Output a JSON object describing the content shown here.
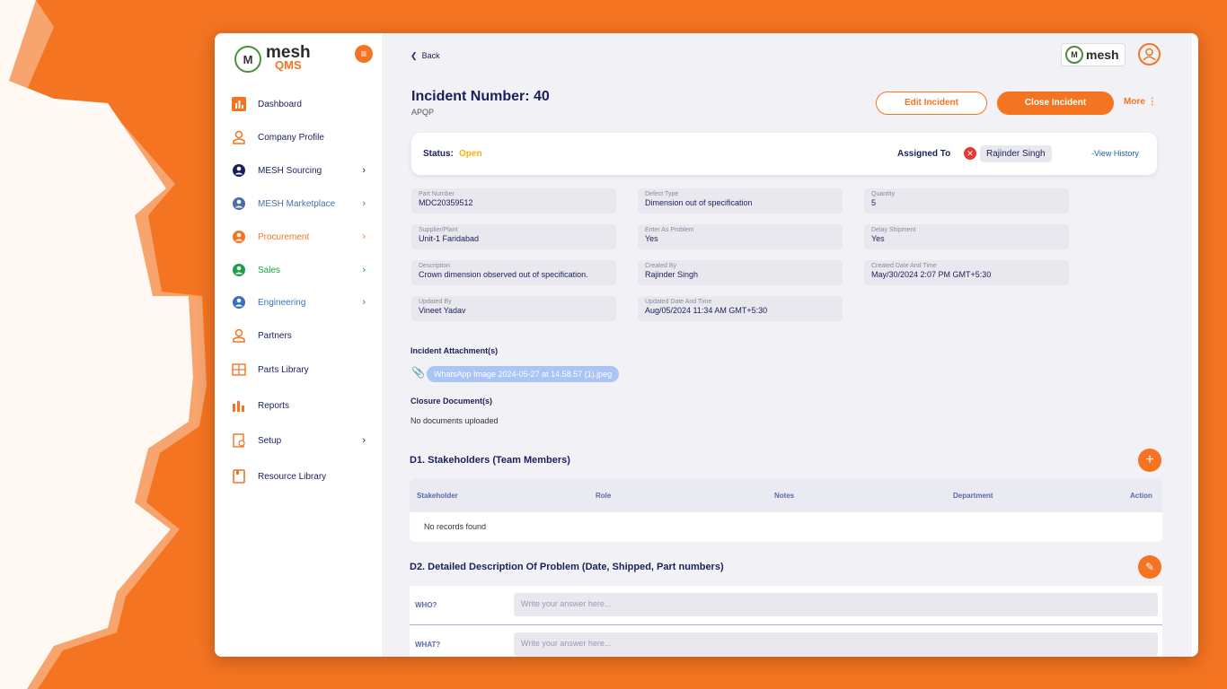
{
  "app": {
    "logo_main": "mesh",
    "logo_sub": "QMS",
    "brand_small": "mesh"
  },
  "sidebar": {
    "items": [
      {
        "label": "Dashboard",
        "icon": "bar-chart-icon",
        "chevron": false,
        "color": "#1a1f5c"
      },
      {
        "label": "Company Profile",
        "icon": "user-outline-icon",
        "chevron": false,
        "color": "#1a1f5c"
      },
      {
        "label": "MESH Sourcing",
        "icon": "user-circle-icon",
        "chevron": true,
        "color": "#1a1f5c"
      },
      {
        "label": "MESH Marketplace",
        "icon": "user-circle-icon",
        "chevron": true,
        "color": "#4a6fa5"
      },
      {
        "label": "Procurement",
        "icon": "user-circle-icon",
        "chevron": true,
        "color": "#f47421"
      },
      {
        "label": "Sales",
        "icon": "user-circle-icon",
        "chevron": true,
        "color": "#1e9e4a"
      },
      {
        "label": "Engineering",
        "icon": "user-circle-icon",
        "chevron": true,
        "color": "#3a6fc8"
      },
      {
        "label": "Partners",
        "icon": "partners-icon",
        "chevron": false,
        "color": "#1a1f5c"
      },
      {
        "label": "Parts Library",
        "icon": "grid-icon",
        "chevron": false,
        "color": "#1a1f5c"
      },
      {
        "label": "Reports",
        "icon": "reports-icon",
        "chevron": false,
        "color": "#1a1f5c"
      },
      {
        "label": "Setup",
        "icon": "setup-icon",
        "chevron": true,
        "color": "#1a1f5c"
      },
      {
        "label": "Resource Library",
        "icon": "book-icon",
        "chevron": false,
        "color": "#1a1f5c"
      }
    ]
  },
  "header": {
    "back_label": "Back",
    "title": "Incident Number: 40",
    "subtitle": "APQP",
    "edit_label": "Edit Incident",
    "close_label": "Close Incident",
    "more_label": "More"
  },
  "status": {
    "status_label": "Status:",
    "status_value": "Open",
    "assigned_label": "Assigned To",
    "assignee": "Rajinder Singh",
    "history_label": "-View History"
  },
  "fields": [
    {
      "label": "Part Number",
      "value": "MDC20359512"
    },
    {
      "label": "Defect Type",
      "value": "Dimension out of specification"
    },
    {
      "label": "Quantity",
      "value": "5"
    },
    {
      "label": "Supplier/Plant",
      "value": "Unit-1  Faridabad"
    },
    {
      "label": "Enter As Problem",
      "value": "Yes"
    },
    {
      "label": "Delay Shipment",
      "value": "Yes"
    },
    {
      "label": "Description",
      "value": "Crown dimension observed out of specification."
    },
    {
      "label": "Created By",
      "value": "Rajinder Singh"
    },
    {
      "label": "Created Date And Time",
      "value": "May/30/2024 2:07 PM GMT+5:30"
    },
    {
      "label": "Updated By",
      "value": "Vineet Yadav"
    },
    {
      "label": "Updated Date And Time",
      "value": "Aug/05/2024 11:34 AM GMT+5:30"
    }
  ],
  "attachments": {
    "heading": "Incident Attachment(s)",
    "file": "WhatsApp Image 2024-05-27 at 14.58.57 (1).jpeg",
    "closure_heading": "Closure Document(s)",
    "closure_empty": "No documents uploaded"
  },
  "d1": {
    "title": "D1. Stakeholders (Team Members)",
    "columns": [
      "Stakeholder",
      "Role",
      "Notes",
      "Department",
      "Action"
    ],
    "empty": "No records found"
  },
  "d2": {
    "title": "D2. Detailed Description Of Problem (Date, Shipped, Part numbers)",
    "rows": [
      {
        "label": "WHO?",
        "placeholder": "Write your answer here..."
      },
      {
        "label": "WHAT?",
        "placeholder": "Write your answer here..."
      }
    ]
  }
}
